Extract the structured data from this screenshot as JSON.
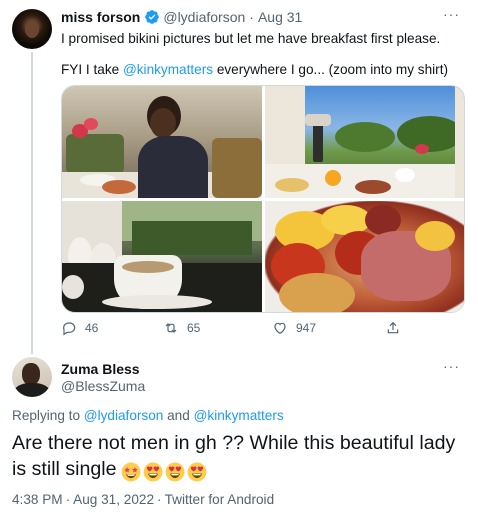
{
  "original_tweet": {
    "author_name": "miss forson",
    "handle": "@lydiaforson",
    "separator": "·",
    "date": "Aug 31",
    "text_line1": "I promised bikini pictures but let me have breakfast first please.",
    "text_line2_prefix": "FYI I take",
    "mention": "@kinkymatters",
    "text_line2_suffix": "everywhere I go... (zoom into my shirt)",
    "more_label": "···",
    "stats": {
      "replies": "46",
      "retweets": "65",
      "likes": "947"
    },
    "photos": [
      "woman-at-breakfast-table",
      "window-view-breakfast-table",
      "teacup-by-window",
      "full-english-breakfast"
    ]
  },
  "reply_tweet": {
    "author_name": "Zuma Bless",
    "handle": "@BlessZuma",
    "more_label": "···",
    "replying_prefix": "Replying to",
    "replying_to_1": "@lydiaforson",
    "replying_and": "and",
    "replying_to_2": "@kinkymatters",
    "text": "Are there not men in gh ?? While this beautiful lady is still single",
    "emojis": [
      "star-struck-emoji",
      "heart-eyes-emoji",
      "heart-eyes-emoji",
      "heart-eyes-emoji"
    ],
    "time": "4:38 PM",
    "date": "Aug 31, 2022",
    "source": "Twitter for Android",
    "separator": "·"
  },
  "colors": {
    "link": "#1d9bf0",
    "secondary_text": "#536471",
    "thread_line": "#cfd9de",
    "verified_badge": "#1d9bf0"
  }
}
